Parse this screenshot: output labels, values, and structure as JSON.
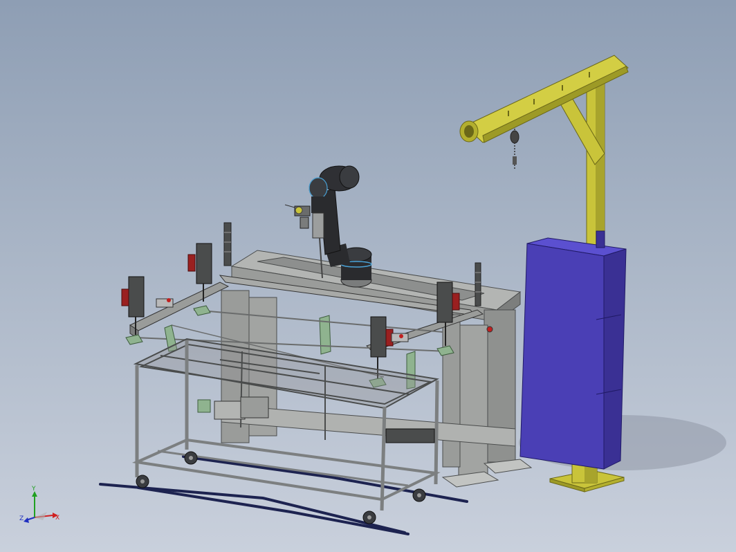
{
  "colors": {
    "background_top": "#8e9eb4",
    "background_bottom": "#c9d0dc",
    "frame_grey": "#9a9c9a",
    "frame_dark": "#5e6060",
    "cart_frame": "#7c7f80",
    "jig_green": "#8fb38f",
    "crane_yellow": "#c9c43a",
    "cabinet_blue": "#4a3fb5",
    "robot_black": "#2a2b2e",
    "clamp_red": "#9a2020",
    "cable_navy": "#1d2350"
  },
  "triad": {
    "x_label": "X",
    "y_label": "Y",
    "z_label": "Z",
    "x_color": "#d02020",
    "y_color": "#20a020",
    "z_color": "#2030c0"
  }
}
